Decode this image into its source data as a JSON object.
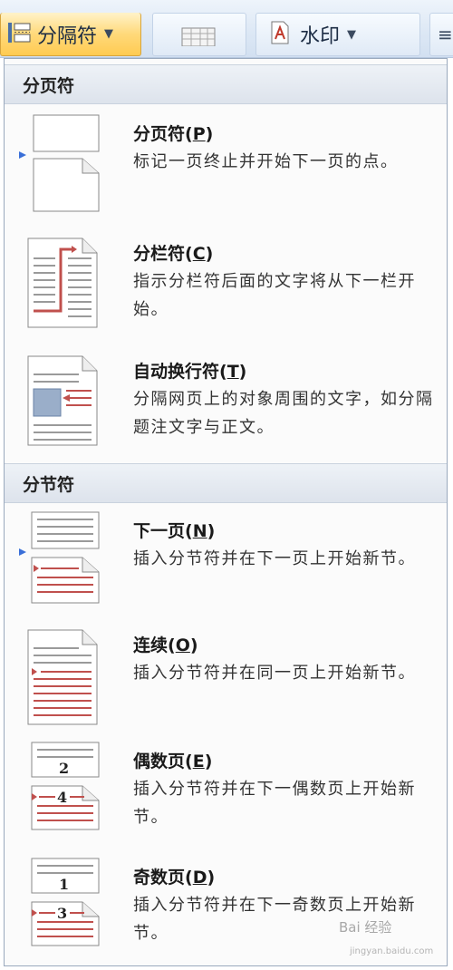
{
  "ribbon": {
    "breaks_label": "分隔符",
    "watermark_label": "水印",
    "edge_label": "≡"
  },
  "menu": {
    "page_breaks_header": "分页符",
    "section_breaks_header": "分节符",
    "items": [
      {
        "title": "分页符",
        "key": "P",
        "desc": "标记一页终止并开始下一页的点。"
      },
      {
        "title": "分栏符",
        "key": "C",
        "desc": "指示分栏符后面的文字将从下一栏开始。"
      },
      {
        "title": "自动换行符",
        "key": "T",
        "desc": "分隔网页上的对象周围的文字，如分隔题注文字与正文。"
      },
      {
        "title": "下一页",
        "key": "N",
        "desc": "插入分节符并在下一页上开始新节。"
      },
      {
        "title": "连续",
        "key": "O",
        "desc": "插入分节符并在同一页上开始新节。"
      },
      {
        "title": "偶数页",
        "key": "E",
        "desc": "插入分节符并在下一偶数页上开始新节。",
        "icon_numbers": [
          "2",
          "4"
        ]
      },
      {
        "title": "奇数页",
        "key": "D",
        "desc": "插入分节符并在下一奇数页上开始新节。",
        "icon_numbers": [
          "1",
          "3"
        ]
      }
    ]
  },
  "watermark": {
    "text": "Bai 经验",
    "sub": "jingyan.baidu.com"
  },
  "colors": {
    "ribbon_active": "#ffd97a",
    "accent_red": "#c0504d",
    "header_bg": "#e3e8ef"
  }
}
